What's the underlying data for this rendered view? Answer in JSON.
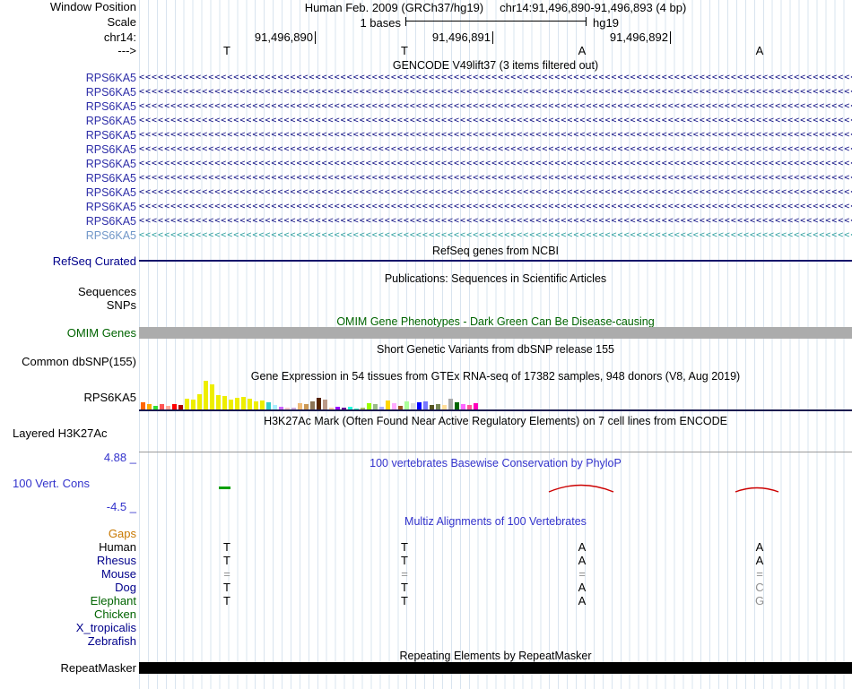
{
  "header": {
    "assembly": "Human Feb. 2009 (GRCh37/hg19)",
    "position": "chr14:91,496,890-91,496,893 (4 bp)",
    "window_position_label": "Window Position",
    "scale_label": "Scale",
    "scale_value": "1 bases",
    "genome": "hg19",
    "chrom_label": "chr14:",
    "coords": [
      "91,496,890",
      "91,496,891",
      "91,496,892"
    ],
    "strand_label": "--->",
    "bases": [
      "T",
      "T",
      "A",
      "A"
    ]
  },
  "tracks": {
    "gencode": {
      "title": "GENCODE V49lift37 (3 items filtered out)",
      "rows": [
        "RPS6KA5",
        "RPS6KA5",
        "RPS6KA5",
        "RPS6KA5",
        "RPS6KA5",
        "RPS6KA5",
        "RPS6KA5",
        "RPS6KA5",
        "RPS6KA5",
        "RPS6KA5",
        "RPS6KA5",
        "RPS6KA5"
      ]
    },
    "refseq": {
      "title": "RefSeq genes from NCBI",
      "label": "RefSeq Curated"
    },
    "publications": {
      "title": "Publications: Sequences in Scientific Articles",
      "label_sequences": "Sequences",
      "label_snps": "SNPs"
    },
    "omim": {
      "title": "OMIM Gene Phenotypes - Dark Green Can Be Disease-causing",
      "label": "OMIM Genes"
    },
    "dbsnp": {
      "title": "Short Genetic Variants from dbSNP release 155",
      "label": "Common dbSNP(155)"
    },
    "gtex": {
      "title": "Gene Expression in 54 tissues from GTEx RNA-seq of 17382 samples, 948 donors (V8, Aug 2019)",
      "label": "RPS6KA5",
      "bars": [
        {
          "c": "#FF6600",
          "h": 9
        },
        {
          "c": "#FFAA00",
          "h": 7
        },
        {
          "c": "#33DD33",
          "h": 5
        },
        {
          "c": "#FF5555",
          "h": 7
        },
        {
          "c": "#FFAA99",
          "h": 5
        },
        {
          "c": "#FF0000",
          "h": 7
        },
        {
          "c": "#AA0000",
          "h": 6
        },
        {
          "c": "#EEEE00",
          "h": 13
        },
        {
          "c": "#EEEE00",
          "h": 12
        },
        {
          "c": "#EEEE00",
          "h": 18
        },
        {
          "c": "#EEEE00",
          "h": 33
        },
        {
          "c": "#EEEE00",
          "h": 29
        },
        {
          "c": "#EEEE00",
          "h": 17
        },
        {
          "c": "#EEEE00",
          "h": 16
        },
        {
          "c": "#EEEE00",
          "h": 12
        },
        {
          "c": "#EEEE00",
          "h": 14
        },
        {
          "c": "#EEEE00",
          "h": 15
        },
        {
          "c": "#EEEE00",
          "h": 13
        },
        {
          "c": "#EEEE00",
          "h": 10
        },
        {
          "c": "#EEEE00",
          "h": 11
        },
        {
          "c": "#33CCCC",
          "h": 9
        },
        {
          "c": "#AAEEFF",
          "h": 6
        },
        {
          "c": "#CC66FF",
          "h": 4
        },
        {
          "c": "#FFCCCC",
          "h": 3
        },
        {
          "c": "#CCAADD",
          "h": 3
        },
        {
          "c": "#EEBB77",
          "h": 8
        },
        {
          "c": "#CC9955",
          "h": 7
        },
        {
          "c": "#8B7355",
          "h": 10
        },
        {
          "c": "#552200",
          "h": 14
        },
        {
          "c": "#BB9988",
          "h": 12
        },
        {
          "c": "#FFCCAA",
          "h": 3
        },
        {
          "c": "#9900FF",
          "h": 4
        },
        {
          "c": "#660099",
          "h": 3
        },
        {
          "c": "#22FFDD",
          "h": 4
        },
        {
          "c": "#33FFC2",
          "h": 2
        },
        {
          "c": "#AABB66",
          "h": 3
        },
        {
          "c": "#99FF00",
          "h": 8
        },
        {
          "c": "#99BB88",
          "h": 7
        },
        {
          "c": "#AAAAFF",
          "h": 4
        },
        {
          "c": "#FFD700",
          "h": 11
        },
        {
          "c": "#FFAAFF",
          "h": 8
        },
        {
          "c": "#995522",
          "h": 5
        },
        {
          "c": "#AAFF99",
          "h": 10
        },
        {
          "c": "#DDDDDD",
          "h": 8
        },
        {
          "c": "#0000FF",
          "h": 9
        },
        {
          "c": "#7777FF",
          "h": 10
        },
        {
          "c": "#555522",
          "h": 6
        },
        {
          "c": "#778855",
          "h": 7
        },
        {
          "c": "#FFDD99",
          "h": 6
        },
        {
          "c": "#AAAAAA",
          "h": 13
        },
        {
          "c": "#006600",
          "h": 9
        },
        {
          "c": "#FF66FF",
          "h": 7
        },
        {
          "c": "#FF5599",
          "h": 6
        },
        {
          "c": "#FF00BB",
          "h": 8
        }
      ]
    },
    "h3k27ac": {
      "title": "H3K27Ac Mark (Often Found Near Active Regulatory Elements) on 7 cell lines from ENCODE",
      "label": "Layered H3K27Ac"
    },
    "phylop": {
      "title": "100 vertebrates Basewise Conservation by PhyloP",
      "label": "100 Vert. Cons",
      "max_label": "4.88 _",
      "min_label": "-4.5 _"
    },
    "multiz": {
      "title": "Multiz Alignments of 100 Vertebrates",
      "species": [
        {
          "name": "Gaps",
          "color": "#c87800",
          "bases": [
            "",
            "",
            "",
            ""
          ]
        },
        {
          "name": "Human",
          "color": "#000000",
          "bases": [
            "T",
            "T",
            "A",
            "A"
          ]
        },
        {
          "name": "Rhesus",
          "color": "#00008b",
          "bases": [
            "T",
            "T",
            "A",
            "A"
          ]
        },
        {
          "name": "Mouse",
          "color": "#00008b",
          "bases": [
            "=",
            "=",
            "=",
            "="
          ],
          "muted": [
            1,
            1,
            1,
            1
          ]
        },
        {
          "name": "Dog",
          "color": "#00008b",
          "bases": [
            "T",
            "T",
            "A",
            "C"
          ],
          "muted": [
            0,
            0,
            0,
            1
          ]
        },
        {
          "name": "Elephant",
          "color": "#006400",
          "bases": [
            "T",
            "T",
            "A",
            "G"
          ],
          "muted": [
            0,
            0,
            0,
            1
          ]
        },
        {
          "name": "Chicken",
          "color": "#006400",
          "bases": [
            "",
            "",
            "",
            ""
          ]
        },
        {
          "name": "X_tropicalis",
          "color": "#00008b",
          "bases": [
            "",
            "",
            "",
            ""
          ]
        },
        {
          "name": "Zebrafish",
          "color": "#00008b",
          "bases": [
            "",
            "",
            "",
            ""
          ]
        }
      ]
    },
    "repeatmasker": {
      "title": "Repeating Elements by RepeatMasker",
      "label": "RepeatMasker"
    }
  },
  "colors": {
    "grid": "#d9e4ef",
    "gencodeBlue": "#0c0c82",
    "gencodeLabel": "#2e2ea8",
    "gencodeLightLabel": "#7096c8",
    "gencodeLightArrow": "#30a0a0",
    "navy": "#00008b",
    "green": "#006400",
    "omimGray": "#acacac",
    "phylopBlue": "#3333cc",
    "gapsOrange": "#c87800",
    "wiggleRed": "#cc0000",
    "wiggleGreen": "#00a000",
    "mutedBase": "#909090"
  }
}
